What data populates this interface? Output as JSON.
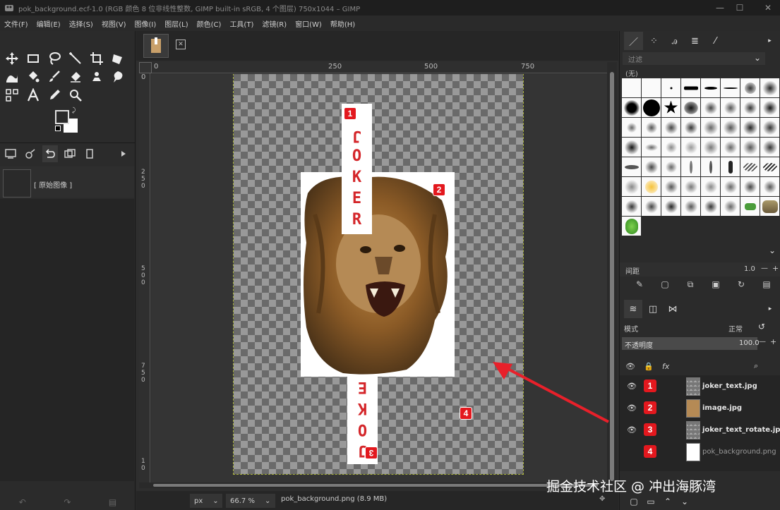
{
  "window": {
    "title": "pok_background.ecf-1.0 (RGB 颜色 8 位非线性整数, GIMP built-in sRGB, 4 个图层) 750x1044 – GIMP",
    "controls": [
      "—",
      "☐",
      "✕"
    ]
  },
  "menubar": [
    "文件(F)",
    "编辑(E)",
    "选择(S)",
    "视图(V)",
    "图像(I)",
    "图层(L)",
    "颜色(C)",
    "工具(T)",
    "滤镜(R)",
    "窗口(W)",
    "帮助(H)"
  ],
  "left_panel": {
    "undo_history": {
      "item_label": "[ 原始图像 ]"
    }
  },
  "rulers": {
    "top": [
      "0",
      "250",
      "500",
      "750"
    ],
    "left": [
      "0",
      "2",
      "5",
      "0",
      "5",
      "0",
      "0",
      "7",
      "5",
      "0",
      "1",
      "0"
    ]
  },
  "canvas": {
    "joker_text_top": [
      "J",
      "O",
      "K",
      "E",
      "R"
    ],
    "joker_text_bottom": [
      "J",
      "O",
      "K",
      "E"
    ],
    "badges": [
      "1",
      "2",
      "3",
      "4"
    ]
  },
  "statusbar": {
    "unit": "px",
    "zoom": "66.7 %",
    "file_info": "pok_background.png (8.9 MB)"
  },
  "right_panel": {
    "filter_placeholder": "过滤",
    "brush_set_label": "(无)",
    "spacing_label": "间距",
    "spacing_value": "1.0",
    "mode_label": "模式",
    "mode_value": "正常",
    "opacity_label": "不透明度",
    "opacity_value": "100.0",
    "layers": [
      {
        "badge": "1",
        "name": "joker_text.jpg",
        "visible": true
      },
      {
        "badge": "2",
        "name": "image.jpg",
        "visible": true
      },
      {
        "badge": "3",
        "name": "joker_text_rotate.jpg",
        "visible": true
      },
      {
        "badge": "4",
        "name": "pok_background.png",
        "visible": false
      }
    ]
  },
  "watermark": "掘金技术社区 @ 冲出海豚湾",
  "colors": {
    "badge_red": "#e3181e",
    "joker_red": "#d4262a",
    "accent_arrow": "#e8202a"
  }
}
